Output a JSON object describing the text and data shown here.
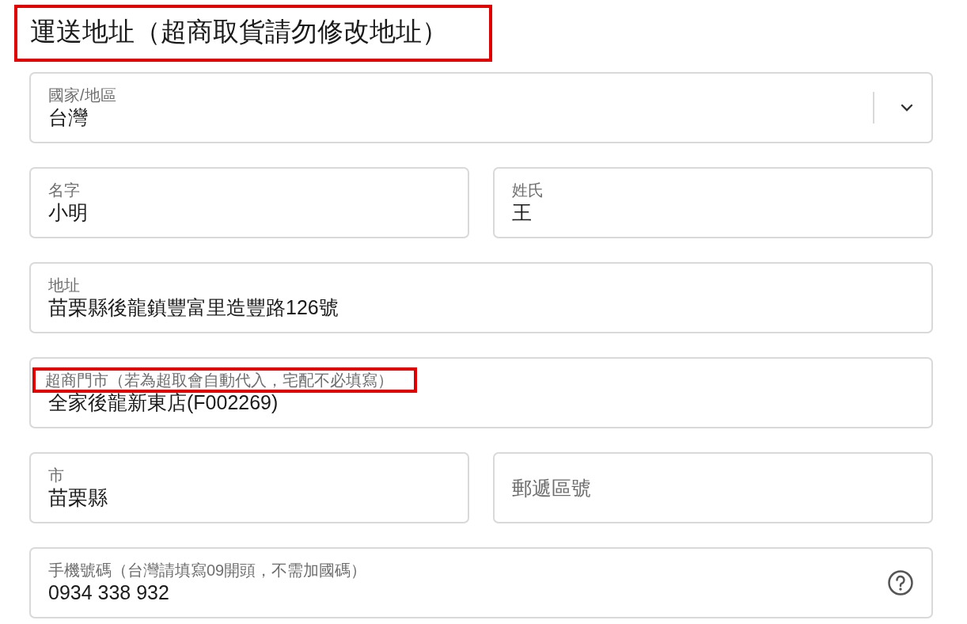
{
  "title": {
    "text": "運送地址（超商取貨請勿修改地址）",
    "highlighted": true
  },
  "rows": [
    [
      {
        "kind": "select",
        "label": "國家/地區",
        "value": "台灣",
        "highlighted": false
      }
    ],
    [
      {
        "kind": "text",
        "label": "名字",
        "value": "小明",
        "highlighted": false
      },
      {
        "kind": "text",
        "label": "姓氏",
        "value": "王",
        "highlighted": false
      }
    ],
    [
      {
        "kind": "text",
        "label": "地址",
        "value": "苗栗縣後龍鎮豐富里造豐路126號",
        "highlighted": false
      }
    ],
    [
      {
        "kind": "text",
        "label": "超商門市（若為超取會自動代入，宅配不必填寫）",
        "value": "全家後龍新東店(F002269)",
        "highlighted": true
      }
    ],
    [
      {
        "kind": "text",
        "label": "市",
        "value": "苗栗縣",
        "highlighted": false
      },
      {
        "kind": "empty",
        "placeholder": "郵遞區號"
      }
    ],
    [
      {
        "kind": "help",
        "label": "手機號碼（台灣請填寫09開頭，不需加國碼）",
        "value": "0934 338 932",
        "highlighted": false
      }
    ]
  ]
}
